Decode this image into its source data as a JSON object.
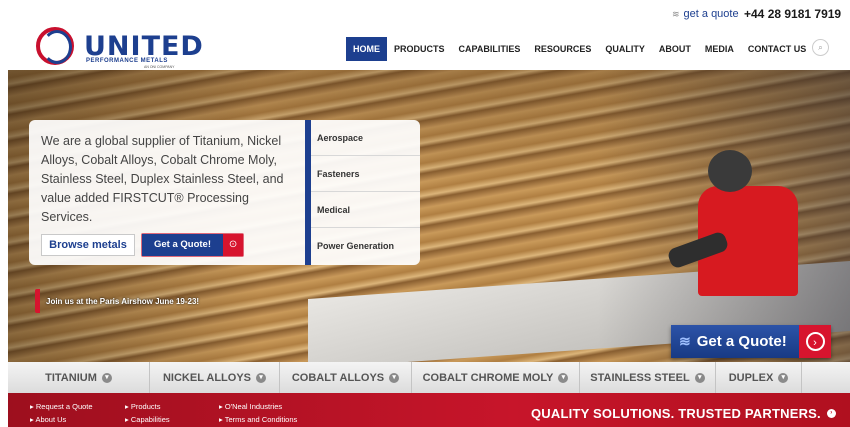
{
  "topbar": {
    "quote_icon": "layers-icon",
    "quote_label": "get a quote",
    "phone": "+44 28 9181 7919"
  },
  "logo": {
    "name": "UNITED",
    "subtitle": "PERFORMANCE METALS",
    "tiny": "AN ONI COMPANY"
  },
  "nav": {
    "items": [
      "HOME",
      "PRODUCTS",
      "CAPABILITIES",
      "RESOURCES",
      "QUALITY",
      "ABOUT",
      "MEDIA",
      "CONTACT US"
    ],
    "active": "HOME",
    "search_icon": "search-icon"
  },
  "hero": {
    "intro": "We are a global supplier of Titanium, Nickel Alloys, Cobalt Alloys, Cobalt Chrome Moly, Stainless Steel, Duplex Stainless Steel, and value added FIRSTCUT® Processing Services.",
    "browse_label": "Browse metals",
    "quote_label": "Get a Quote!",
    "industries": [
      "Aerospace",
      "Fasteners",
      "Medical",
      "Power Generation"
    ],
    "announcement": "Join us at the Paris Airshow June 19-23!",
    "big_quote_label": "Get a Quote!"
  },
  "metals": [
    "TITANIUM",
    "NICKEL ALLOYS",
    "COBALT ALLOYS",
    "COBALT CHROME MOLY",
    "STAINLESS STEEL",
    "DUPLEX"
  ],
  "footer": {
    "col1": [
      "Request a Quote",
      "About Us"
    ],
    "col2": [
      "Products",
      "Capabilities"
    ],
    "col3": [
      "O'Neal Industries",
      "Terms and Conditions"
    ],
    "tagline": "QUALITY SOLUTIONS. TRUSTED PARTNERS."
  },
  "colors": {
    "brand_blue": "#1d3f8f",
    "brand_red": "#d7142e"
  }
}
